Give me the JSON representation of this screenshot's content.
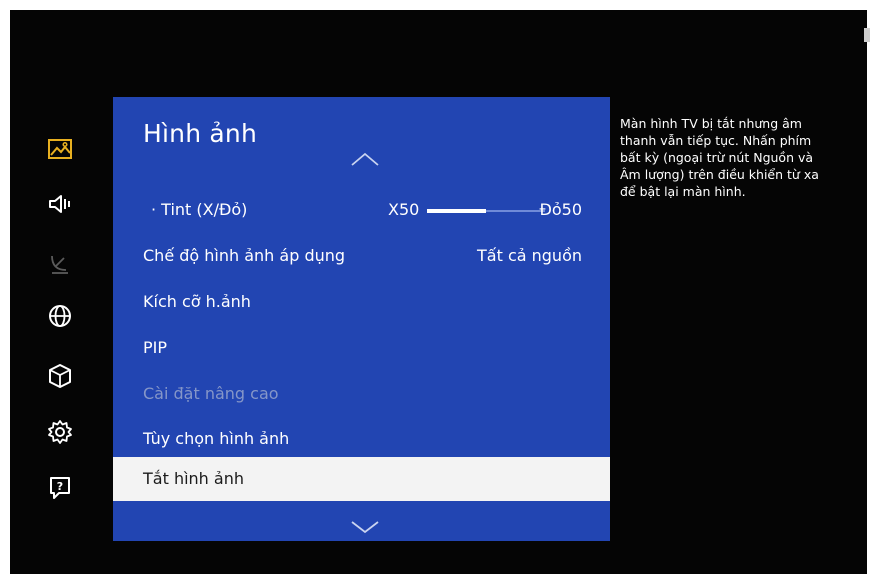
{
  "rail": {
    "icons": [
      {
        "name": "picture-icon",
        "active": true
      },
      {
        "name": "sound-icon",
        "active": false
      },
      {
        "name": "broadcast-icon",
        "active": false,
        "dimmed": true
      },
      {
        "name": "network-icon",
        "active": false
      },
      {
        "name": "smart-features-icon",
        "active": false
      },
      {
        "name": "system-icon",
        "active": false
      },
      {
        "name": "support-icon",
        "active": false
      }
    ],
    "active_color": "#e8b020"
  },
  "menu": {
    "title": "Hình ảnh",
    "items": [
      {
        "label": "Tint (X/Đỏ)",
        "type": "slider",
        "left_value": "X50",
        "right_value": "Đỏ50",
        "level": 0.5
      },
      {
        "label": "Chế độ hình ảnh áp dụng",
        "value": "Tất cả nguồn"
      },
      {
        "label": "Kích cỡ h.ảnh"
      },
      {
        "label": "PIP"
      },
      {
        "label": "Cài đặt nâng cao",
        "disabled": true
      },
      {
        "label": "Tùy chọn hình ảnh"
      },
      {
        "label": "Tắt hình ảnh",
        "selected": true
      }
    ]
  },
  "help_text": "Màn hình TV bị tắt nhưng âm thanh vẫn tiếp tục. Nhấn phím bất kỳ (ngoại trừ nút Nguồn và Âm lượng) trên điều khiển từ xa để bật lại màn hình.",
  "colors": {
    "panel": "#2245b2",
    "background": "#050505",
    "selected_row": "#f3f3f3",
    "disabled_text": "#8596c8"
  }
}
